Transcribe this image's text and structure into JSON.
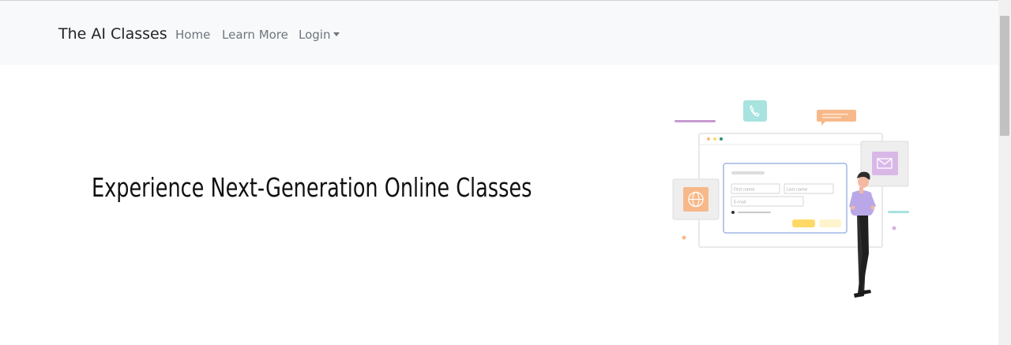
{
  "navbar": {
    "brand": "The AI Classes",
    "links": [
      {
        "label": "Home"
      },
      {
        "label": "Learn More"
      },
      {
        "label": "Login",
        "icon": "caret-down-icon"
      }
    ]
  },
  "hero": {
    "title": "Experience Next-Generation Online Classes"
  },
  "illustration": {
    "form": {
      "first_name_placeholder": "First name",
      "last_name_placeholder": "Last name",
      "email_placeholder": "E-mail"
    }
  },
  "colors": {
    "navbar_bg": "#f8f9fa",
    "nav_link": "#6c757d",
    "accent_yellow": "#ffd966",
    "accent_orange": "#f7b98a",
    "accent_teal": "#a7e3df",
    "accent_purple": "#b58fd0"
  }
}
